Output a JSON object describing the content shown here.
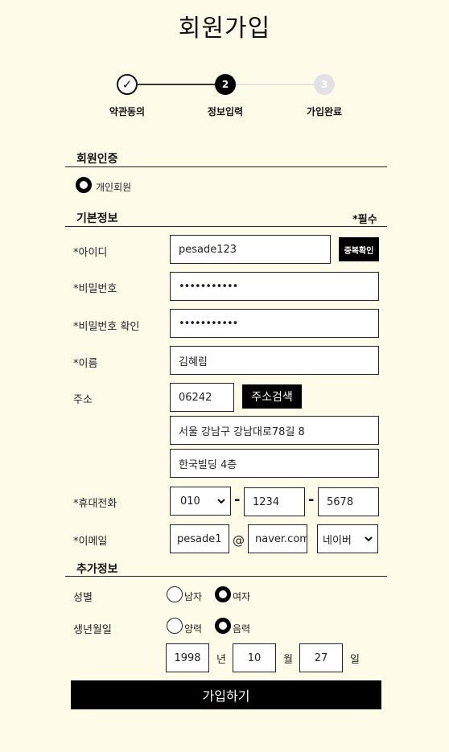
{
  "page_title": "회원가입",
  "steps": [
    {
      "num": "✓",
      "label": "약관동의",
      "state": "done"
    },
    {
      "num": "2",
      "label": "정보입력",
      "state": "current"
    },
    {
      "num": "3",
      "label": "가입완료",
      "state": "todo"
    }
  ],
  "auth_section": {
    "title": "회원인증",
    "option_label": "개인회원"
  },
  "basic_section": {
    "title": "기본정보",
    "required_note": "*필수",
    "id_label": "*아이디",
    "id_value": "pesade123",
    "id_check_button": "중복확인",
    "password_label": "*비밀번호",
    "password_value": "•••••••••••",
    "password_confirm_label": "*비밀번호 확인",
    "password_confirm_value": "•••••••••••",
    "name_label": "*이름",
    "name_value": "김혜림",
    "address_label": "주소",
    "zip_value": "06242",
    "address_search_button": "주소검색",
    "address_line1": "서울 강남구 강남대로78길 8",
    "address_line2": "한국빌딩 4층",
    "phone_label": "*휴대전화",
    "phone_prefix": "010",
    "phone_middle": "1234",
    "phone_last": "5678",
    "phone_dash": "-",
    "email_label": "*이메일",
    "email_local": "pesade1",
    "email_at": "@",
    "email_domain": "naver.com",
    "email_provider": "네이버"
  },
  "extra_section": {
    "title": "추가정보",
    "gender_label": "성별",
    "gender_male": "남자",
    "gender_female": "여자",
    "birth_label": "생년월일",
    "calendar_solar": "양력",
    "calendar_lunar": "음력",
    "birth_year": "1998",
    "year_unit": "년",
    "birth_month": "10",
    "month_unit": "월",
    "birth_day": "27",
    "day_unit": "일"
  },
  "submit_label": "가입하기"
}
